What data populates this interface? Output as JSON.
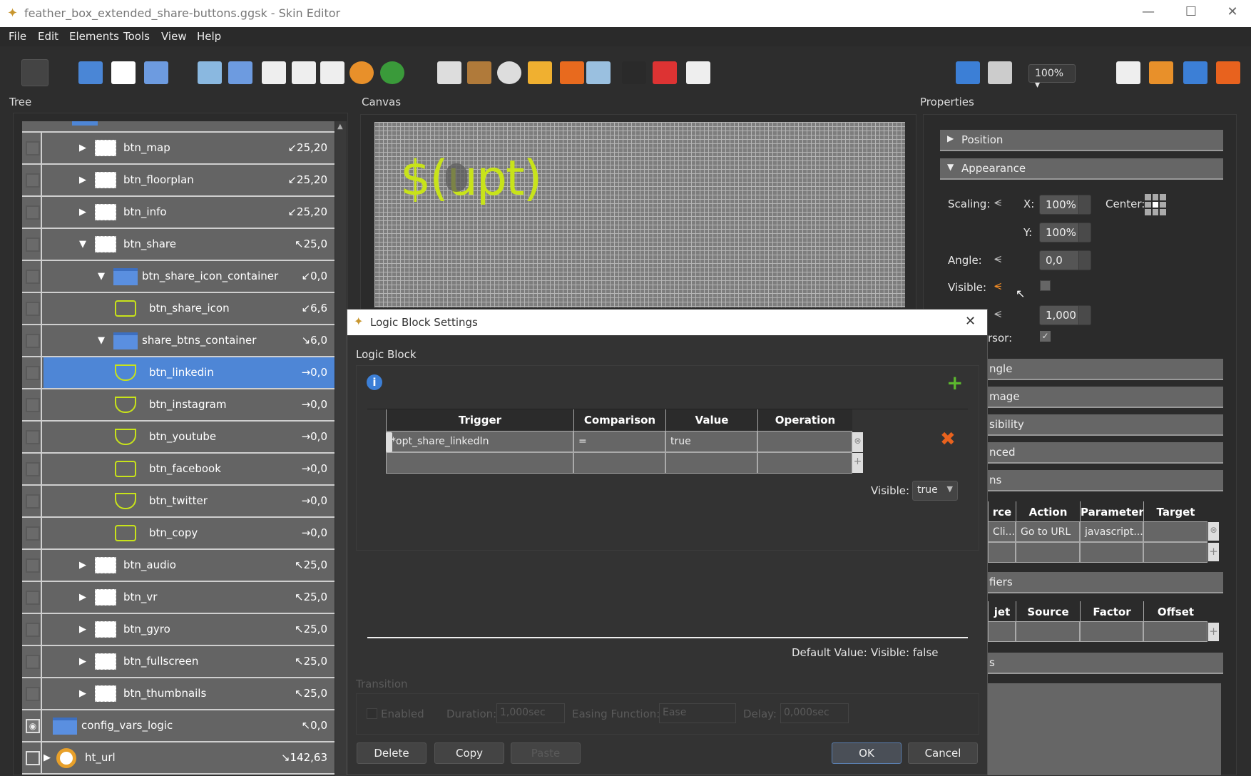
{
  "window": {
    "title": "feather_box_extended_share-buttons.ggsk - Skin Editor",
    "minimize": "—",
    "maximize": "☐",
    "close": "✕"
  },
  "menu": [
    "File",
    "Edit",
    "Elements",
    "Tools",
    "View",
    "Help"
  ],
  "toolbar": {
    "zoom_value": "100%",
    "icons": [
      "pointer-icon",
      "folder-icon",
      "rectangle-icon",
      "text-icon",
      "image-icon",
      "button-icon",
      "svg-icon",
      "lottie-icon",
      "pdf-icon",
      "globe-icon",
      "map-icon",
      "cloner-icon",
      "grid-icon",
      "dial-icon",
      "hotspot-icon",
      "marker-icon",
      "mapimage-icon",
      "video-icon",
      "scrollbar-icon",
      "code-icon",
      "undo-icon",
      "zoom-icon",
      "preview-icon",
      "palette-icon",
      "translate-icon",
      "tools-icon"
    ]
  },
  "panels": {
    "tree": "Tree",
    "canvas": "Canvas",
    "properties": "Properties"
  },
  "canvas": {
    "text": "$(upt)",
    "accent": "#c8e31a"
  },
  "tree": [
    {
      "name": "btn_map",
      "icon": "rect",
      "expand": "collapsed",
      "level": 1,
      "offset": "↙25,20"
    },
    {
      "name": "btn_floorplan",
      "icon": "rect",
      "expand": "collapsed",
      "level": 1,
      "offset": "↙25,20"
    },
    {
      "name": "btn_info",
      "icon": "rect",
      "expand": "collapsed",
      "level": 1,
      "offset": "↙25,20"
    },
    {
      "name": "btn_share",
      "icon": "rect",
      "expand": "expanded",
      "level": 1,
      "offset": "↖25,0"
    },
    {
      "name": "btn_share_icon_container",
      "icon": "folder",
      "expand": "expanded",
      "level": 2,
      "offset": "↙0,0"
    },
    {
      "name": "btn_share_icon",
      "icon": "share",
      "expand": "none",
      "level": 3,
      "offset": "↙6,6"
    },
    {
      "name": "share_btns_container",
      "icon": "folder",
      "expand": "expanded",
      "level": 2,
      "offset": "↘6,0"
    },
    {
      "name": "btn_linkedin",
      "icon": "twitter",
      "expand": "none",
      "level": 3,
      "offset": "→0,0",
      "selected": true
    },
    {
      "name": "btn_instagram",
      "icon": "twitter",
      "expand": "none",
      "level": 3,
      "offset": "→0,0"
    },
    {
      "name": "btn_youtube",
      "icon": "twitter",
      "expand": "none",
      "level": 3,
      "offset": "→0,0"
    },
    {
      "name": "btn_facebook",
      "icon": "facebook",
      "expand": "none",
      "level": 3,
      "offset": "→0,0"
    },
    {
      "name": "btn_twitter",
      "icon": "twitter",
      "expand": "none",
      "level": 3,
      "offset": "→0,0"
    },
    {
      "name": "btn_copy",
      "icon": "copy",
      "expand": "none",
      "level": 3,
      "offset": "→0,0"
    },
    {
      "name": "btn_audio",
      "icon": "rect",
      "expand": "collapsed",
      "level": 1,
      "offset": "↖25,0"
    },
    {
      "name": "btn_vr",
      "icon": "rect",
      "expand": "collapsed",
      "level": 1,
      "offset": "↖25,0"
    },
    {
      "name": "btn_gyro",
      "icon": "rect",
      "expand": "collapsed",
      "level": 1,
      "offset": "↖25,0"
    },
    {
      "name": "btn_fullscreen",
      "icon": "rect",
      "expand": "collapsed",
      "level": 1,
      "offset": "↖25,0"
    },
    {
      "name": "btn_thumbnails",
      "icon": "rect",
      "expand": "collapsed",
      "level": 1,
      "offset": "↖25,0"
    },
    {
      "name": "config_vars_logic",
      "icon": "folder",
      "expand": "none",
      "level": 0,
      "offset": "↖0,0",
      "eye": true
    },
    {
      "name": "ht_url",
      "icon": "hotspot",
      "expand": "collapsed",
      "level": -1,
      "offset": "↘142,63",
      "checkbox": true
    }
  ],
  "properties": {
    "position": "Position",
    "appearance": "Appearance",
    "scaling_label": "Scaling:",
    "x_label": "X:",
    "x_value": "100%",
    "center_label": "Center:",
    "y_label": "Y:",
    "y_value": "100%",
    "angle_label": "Angle:",
    "angle_value": "0,0",
    "visible_label": "Visible:",
    "alpha_value": "1,000",
    "cursor_label": "rsor:",
    "sections": [
      "ngle",
      "mage",
      "sibility",
      "nced",
      "ns"
    ],
    "actions_headers": [
      "rce",
      "Action",
      "Parameters",
      "Target"
    ],
    "actions_row": [
      "Cli...",
      "Go to URL",
      "javascript...",
      ""
    ],
    "modifiers": "fiers",
    "modifier_headers": [
      "jet",
      "Source",
      "Factor",
      "Offset"
    ],
    "last_section": "s"
  },
  "dialog": {
    "title": "Logic Block Settings",
    "close": "✕",
    "group": "Logic Block",
    "headers": [
      "Trigger",
      "Comparison",
      "Value",
      "Operation"
    ],
    "rows": [
      [
        "*opt_share_linkedIn",
        "=",
        "true",
        ""
      ],
      [
        "",
        "",
        "",
        ""
      ]
    ],
    "visible_label": "Visible:",
    "visible_value": "true",
    "default_label": "Default Value:",
    "default_value": "Visible:  false",
    "transition": "Transition",
    "enabled": "Enabled",
    "duration_label": "Duration:",
    "duration": "1,000sec",
    "easing_label": "Easing Function:",
    "easing": "Ease",
    "delay_label": "Delay:",
    "delay": "0,000sec",
    "buttons": {
      "delete": "Delete",
      "copy": "Copy",
      "paste": "Paste",
      "ok": "OK",
      "cancel": "Cancel"
    }
  }
}
